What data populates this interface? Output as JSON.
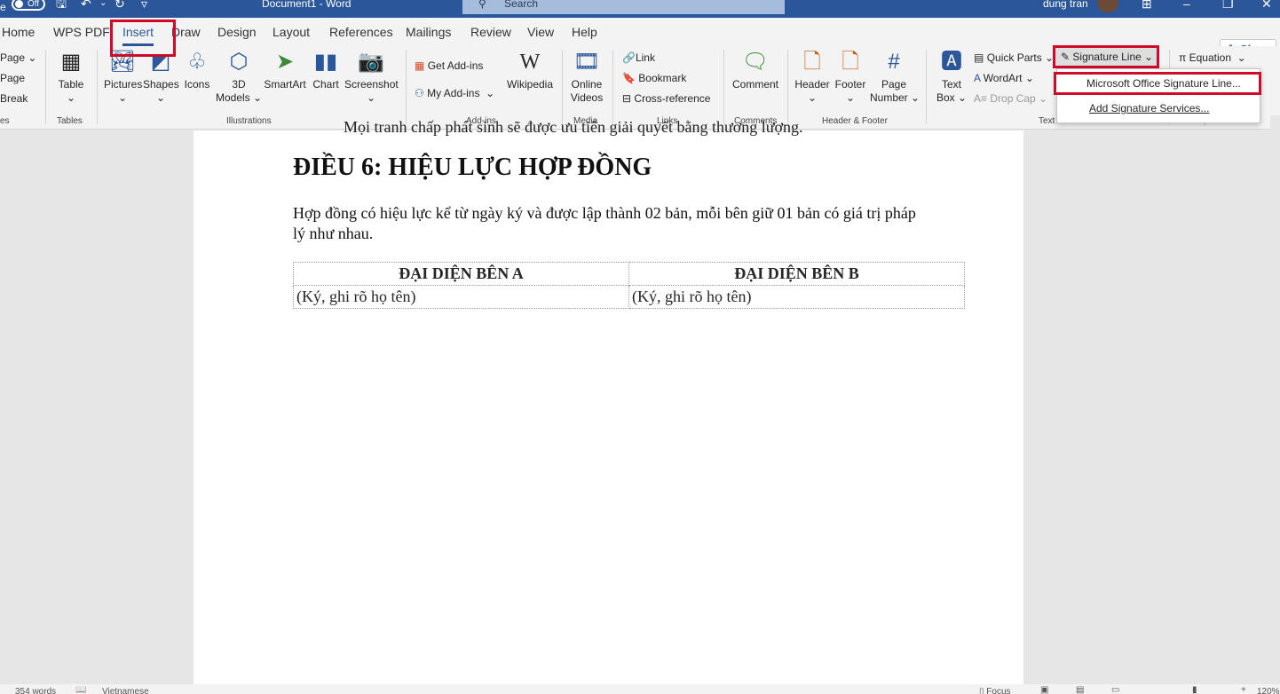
{
  "titlebar": {
    "autosave_partial": "e",
    "autosave_state": "Off",
    "doc_title": "Document1 - Word",
    "search_placeholder": "Search",
    "user": "dung tran",
    "customize_glyph": "▿"
  },
  "tabs": [
    "Home",
    "WPS PDF",
    "Insert",
    "Draw",
    "Design",
    "Layout",
    "References",
    "Mailings",
    "Review",
    "View",
    "Help"
  ],
  "share_label": "Share",
  "ribbon": {
    "pages": {
      "items": [
        "Page",
        "Page",
        "Break"
      ],
      "group": "es"
    },
    "table": {
      "label": "Table",
      "group": "Tables"
    },
    "illustrations": {
      "pictures": "Pictures",
      "shapes": "Shapes",
      "icons": "Icons",
      "models_line1": "3D",
      "models_line2": "Models",
      "smartart": "SmartArt",
      "chart": "Chart",
      "screenshot": "Screenshot",
      "group": "Illustrations"
    },
    "addins": {
      "get": "Get Add-ins",
      "my": "My Add-ins",
      "wikipedia": "Wikipedia",
      "group": "Add-ins"
    },
    "media": {
      "line1": "Online",
      "line2": "Videos",
      "group": "Media"
    },
    "links": {
      "link": "Link",
      "bookmark": "Bookmark",
      "crossref": "Cross-reference",
      "group": "Links"
    },
    "comments": {
      "comment": "Comment",
      "group": "Comments"
    },
    "header_footer": {
      "header": "Header",
      "footer": "Footer",
      "page_number_line1": "Page",
      "page_number_line2": "Number",
      "group": "Header & Footer"
    },
    "text": {
      "textbox_line1": "Text",
      "textbox_line2": "Box",
      "quickparts": "Quick Parts",
      "wordart": "WordArt",
      "dropcap": "Drop Cap",
      "group": "Text"
    },
    "signature_line": "Signature Line",
    "equation": "Equation",
    "symbols_group": "Symbols"
  },
  "signature_menu": {
    "ms_office": "Microsoft Office Signature Line...",
    "add_services": "Add Signature Services..."
  },
  "document": {
    "cut_line": "Mọi tranh chấp phát sinh sẽ được ưu tiên giải quyết bằng thương lượng.",
    "heading": "ĐIỀU 6: HIỆU LỰC HỢP ĐỒNG",
    "body": "Hợp đồng có hiệu lực kể từ ngày ký và được lập thành 02 bản, mỗi bên giữ 01 bản có giá trị pháp lý như nhau.",
    "table": {
      "headers": [
        "ĐẠI DIỆN BÊN A",
        "ĐẠI DIỆN BÊN B"
      ],
      "row": [
        "(Ký, ghi rõ họ tên)",
        "(Ký, ghi rõ họ tên)"
      ]
    }
  },
  "statusbar": {
    "words": "354 words",
    "language": "Vietnamese",
    "focus": "Focus",
    "zoom": "120%"
  },
  "colors": {
    "accent": "#2b579a",
    "highlight": "#d10a2a"
  }
}
